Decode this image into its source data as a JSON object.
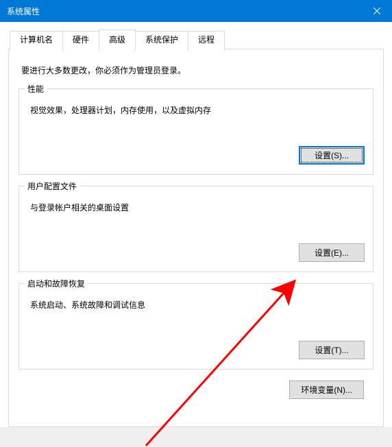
{
  "titlebar": {
    "title": "系统属性"
  },
  "tabs": [
    {
      "label": "计算机名"
    },
    {
      "label": "硬件"
    },
    {
      "label": "高级"
    },
    {
      "label": "系统保护"
    },
    {
      "label": "远程"
    }
  ],
  "active_tab_index": 2,
  "intro": "要进行大多数更改，你必须作为管理员登录。",
  "groups": {
    "performance": {
      "title": "性能",
      "desc": "视觉效果，处理器计划，内存使用，以及虚拟内存",
      "button": "设置(S)..."
    },
    "user_profiles": {
      "title": "用户配置文件",
      "desc": "与登录帐户相关的桌面设置",
      "button": "设置(E)..."
    },
    "startup_recovery": {
      "title": "启动和故障恢复",
      "desc": "系统启动、系统故障和调试信息",
      "button": "设置(T)..."
    }
  },
  "env_button": "环境变量(N)..."
}
